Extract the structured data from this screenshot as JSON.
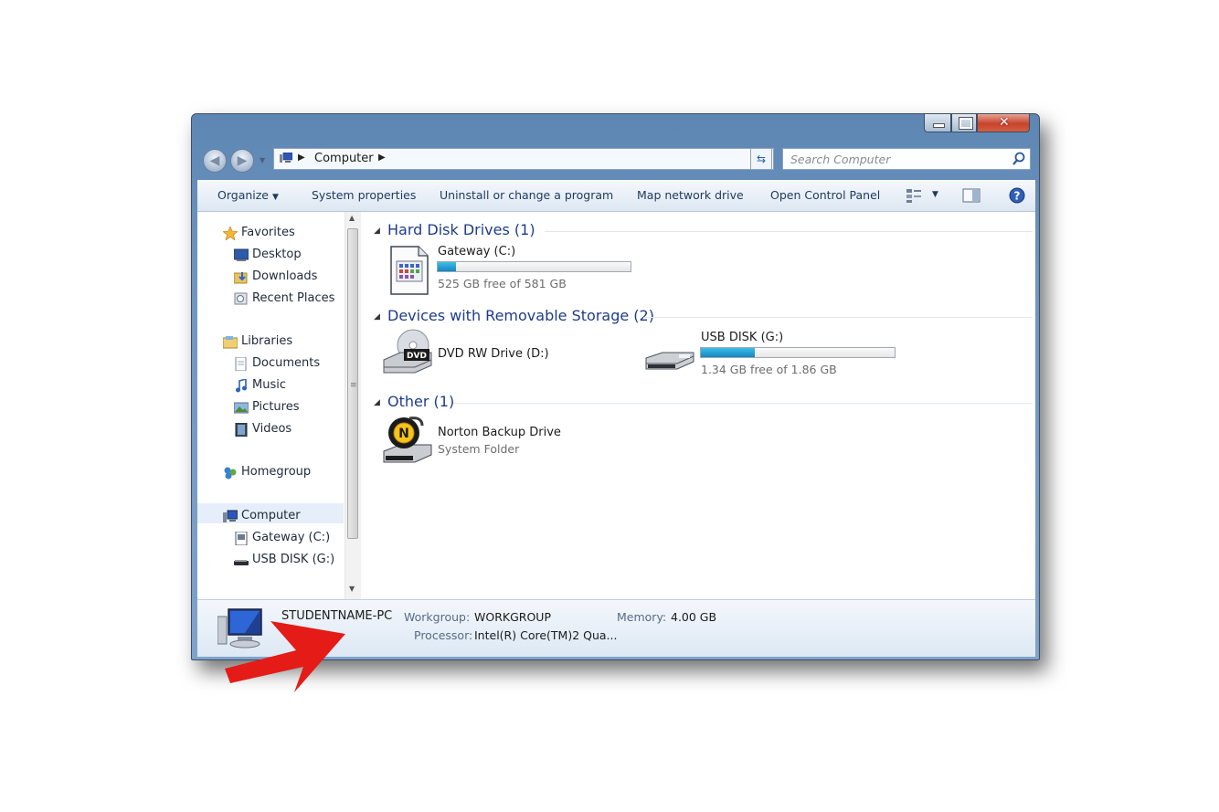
{
  "window": {
    "title_buttons": [
      "minimize",
      "maximize",
      "close"
    ]
  },
  "navbar": {
    "breadcrumb": "Computer",
    "search_placeholder": "Search Computer"
  },
  "toolbar": {
    "organize": "Organize",
    "system_properties": "System properties",
    "uninstall": "Uninstall or change a program",
    "map_network": "Map network drive",
    "open_control_panel": "Open Control Panel"
  },
  "sidebar": {
    "favorites": "Favorites",
    "desktop": "Desktop",
    "downloads": "Downloads",
    "recent_places": "Recent Places",
    "libraries": "Libraries",
    "documents": "Documents",
    "music": "Music",
    "pictures": "Pictures",
    "videos": "Videos",
    "homegroup": "Homegroup",
    "computer": "Computer",
    "gateway": "Gateway (C:)",
    "usb": "USB DISK (G:)"
  },
  "groups": {
    "hdd": "Hard Disk Drives (1)",
    "removable": "Devices with Removable Storage (2)",
    "other": "Other (1)"
  },
  "drives": {
    "gateway": {
      "name": "Gateway (C:)",
      "free": "525 GB free of 581 GB",
      "used_fraction": 0.096
    },
    "dvd": {
      "name": "DVD RW Drive (D:)",
      "icon_label": "DVD"
    },
    "usb": {
      "name": "USB DISK (G:)",
      "free": "1.34 GB free of 1.86 GB",
      "used_fraction": 0.28
    },
    "norton": {
      "name": "Norton Backup Drive",
      "sub": "System Folder"
    }
  },
  "details": {
    "pc_name": "STUDENTNAME-PC",
    "workgroup_label": "Workgroup:",
    "workgroup": "WORKGROUP",
    "memory_label": "Memory:",
    "memory": "4.00 GB",
    "processor_label": "Processor:",
    "processor": "Intel(R) Core(TM)2 Qua..."
  },
  "colors": {
    "annotation_arrow": "#e41b17",
    "group_header": "#1e3c8c",
    "bar_fill": "#1f95cf"
  }
}
